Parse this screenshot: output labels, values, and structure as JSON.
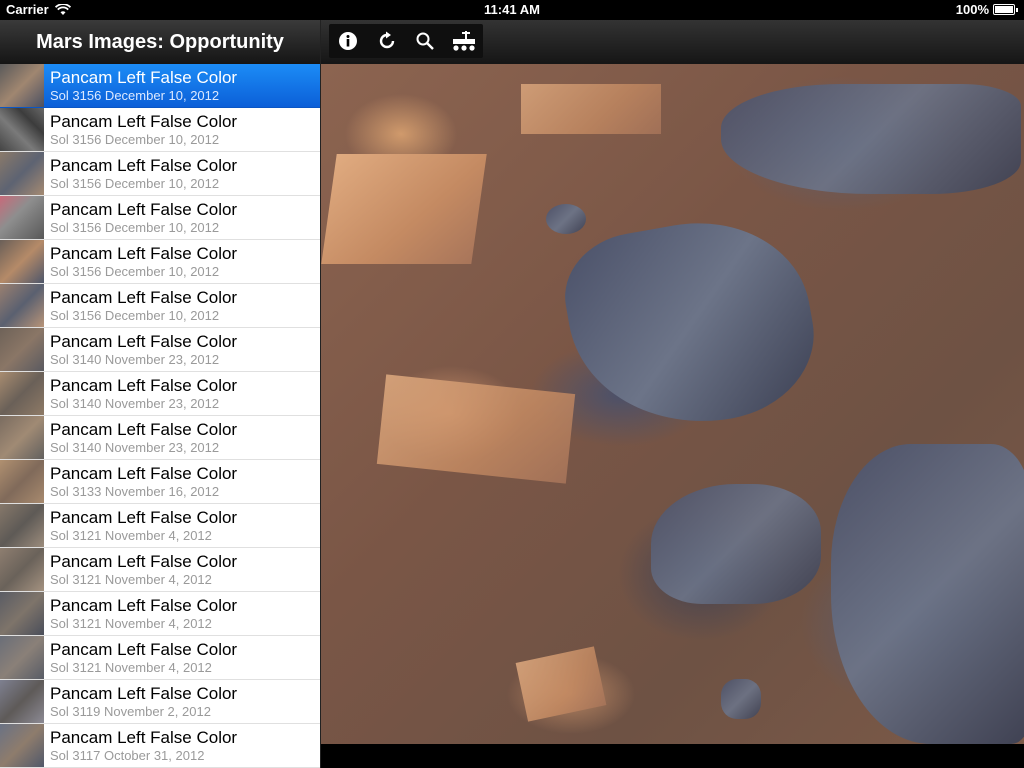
{
  "status_bar": {
    "carrier": "Carrier",
    "time": "11:41 AM",
    "battery": "100%"
  },
  "master": {
    "title": "Mars Images: Opportunity",
    "rows": [
      {
        "title": "Pancam Left False Color",
        "subtitle": "Sol 3156  December 10, 2012",
        "selected": true
      },
      {
        "title": "Pancam Left False Color",
        "subtitle": "Sol 3156  December 10, 2012"
      },
      {
        "title": "Pancam Left False Color",
        "subtitle": "Sol 3156  December 10, 2012"
      },
      {
        "title": "Pancam Left False Color",
        "subtitle": "Sol 3156  December 10, 2012"
      },
      {
        "title": "Pancam Left False Color",
        "subtitle": "Sol 3156  December 10, 2012"
      },
      {
        "title": "Pancam Left False Color",
        "subtitle": "Sol 3156  December 10, 2012"
      },
      {
        "title": "Pancam Left False Color",
        "subtitle": "Sol 3140  November 23, 2012"
      },
      {
        "title": "Pancam Left False Color",
        "subtitle": "Sol 3140  November 23, 2012"
      },
      {
        "title": "Pancam Left False Color",
        "subtitle": "Sol 3140  November 23, 2012"
      },
      {
        "title": "Pancam Left False Color",
        "subtitle": "Sol 3133  November 16, 2012"
      },
      {
        "title": "Pancam Left False Color",
        "subtitle": "Sol 3121  November 4, 2012"
      },
      {
        "title": "Pancam Left False Color",
        "subtitle": "Sol 3121  November 4, 2012"
      },
      {
        "title": "Pancam Left False Color",
        "subtitle": "Sol 3121  November 4, 2012"
      },
      {
        "title": "Pancam Left False Color",
        "subtitle": "Sol 3121  November 4, 2012"
      },
      {
        "title": "Pancam Left False Color",
        "subtitle": "Sol 3119  November 2, 2012"
      },
      {
        "title": "Pancam Left False Color",
        "subtitle": "Sol 3117  October 31, 2012"
      }
    ]
  },
  "toolbar": {
    "icons": [
      "info-icon",
      "refresh-icon",
      "search-icon",
      "rover-icon"
    ]
  },
  "colors": {
    "selection": "#0b5fd8",
    "header": "#1a1a1a"
  }
}
